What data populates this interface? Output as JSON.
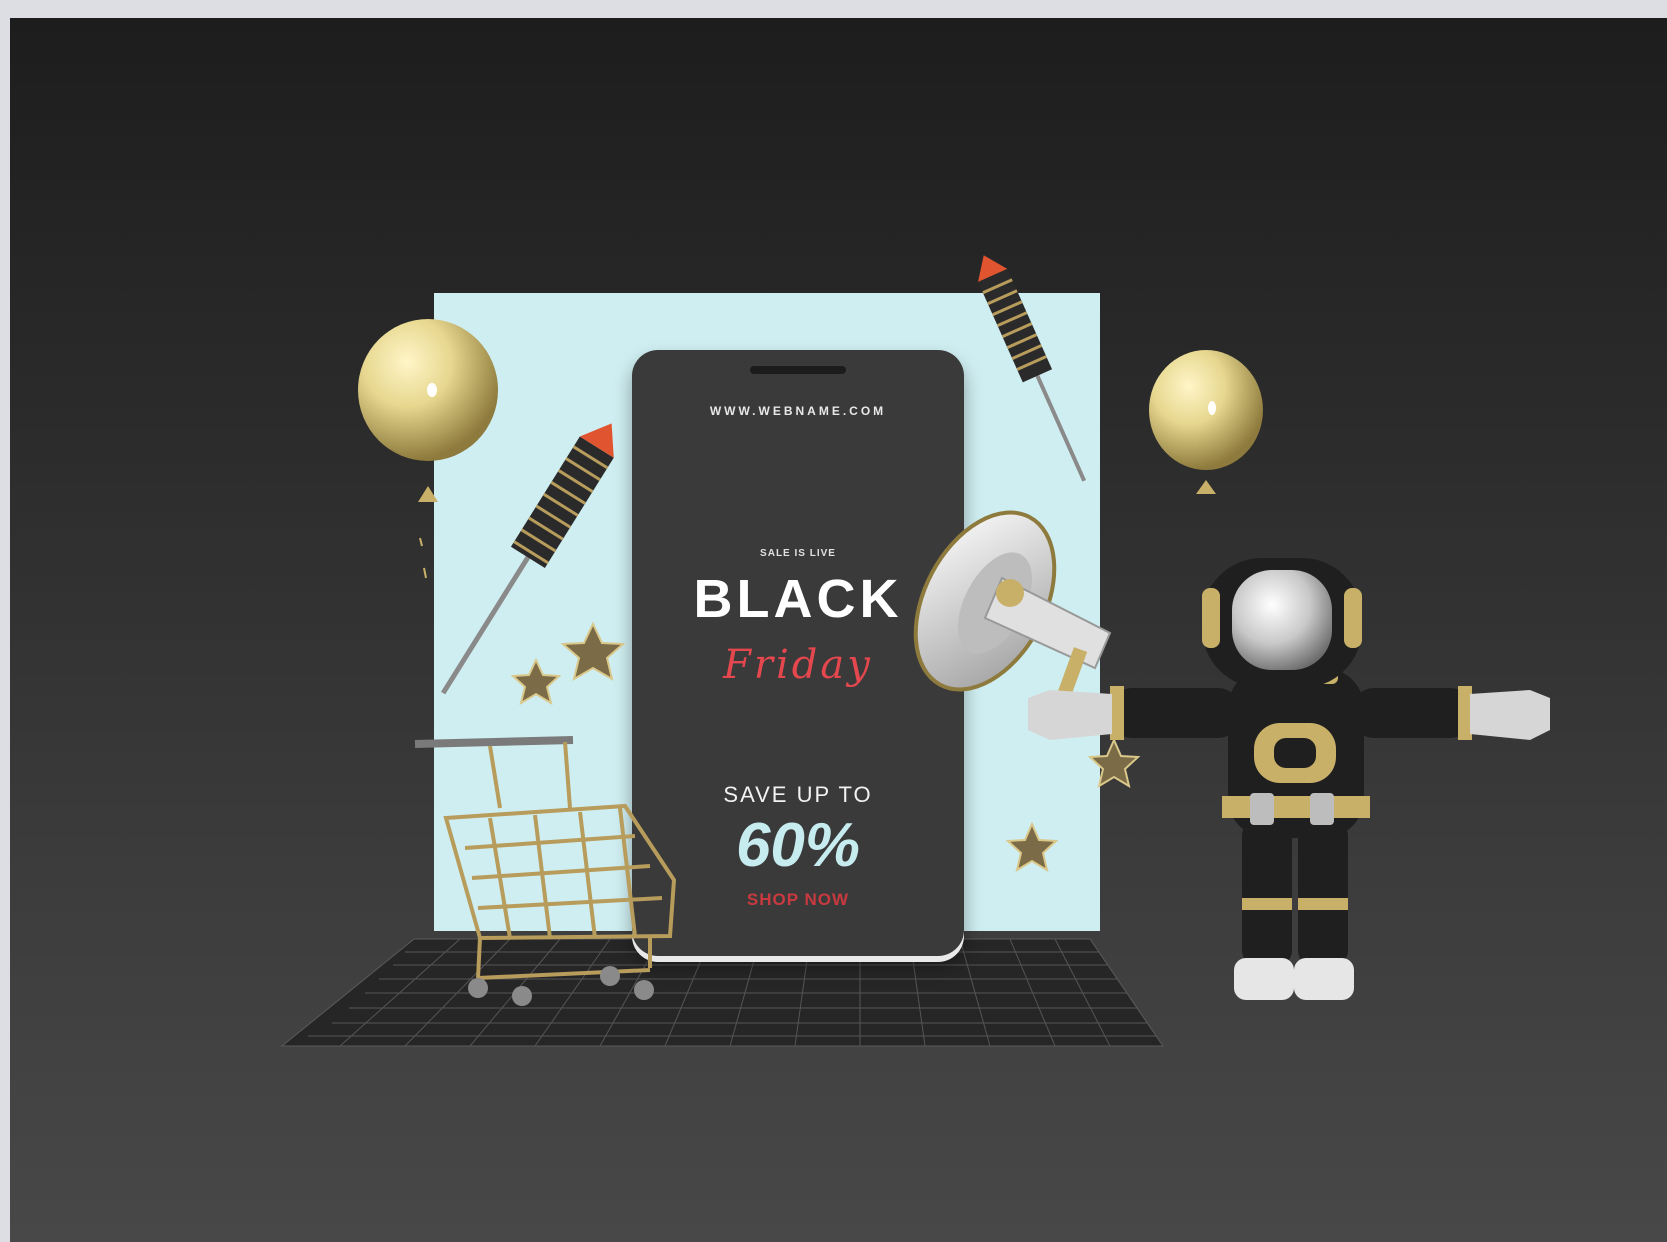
{
  "promo": {
    "url": "WWW.WEBNAME.COM",
    "sale_status": "SALE IS LIVE",
    "headline": "BLACK",
    "subheadline": "Friday",
    "offer": "SAVE UP TO",
    "discount": "60%",
    "cta": "SHOP NOW"
  },
  "colors": {
    "backdrop": "#cfeef1",
    "phone": "#3a3a3a",
    "accent_red": "#e4474e",
    "gold": "#c8b068",
    "balloon": "#e7d78f"
  }
}
